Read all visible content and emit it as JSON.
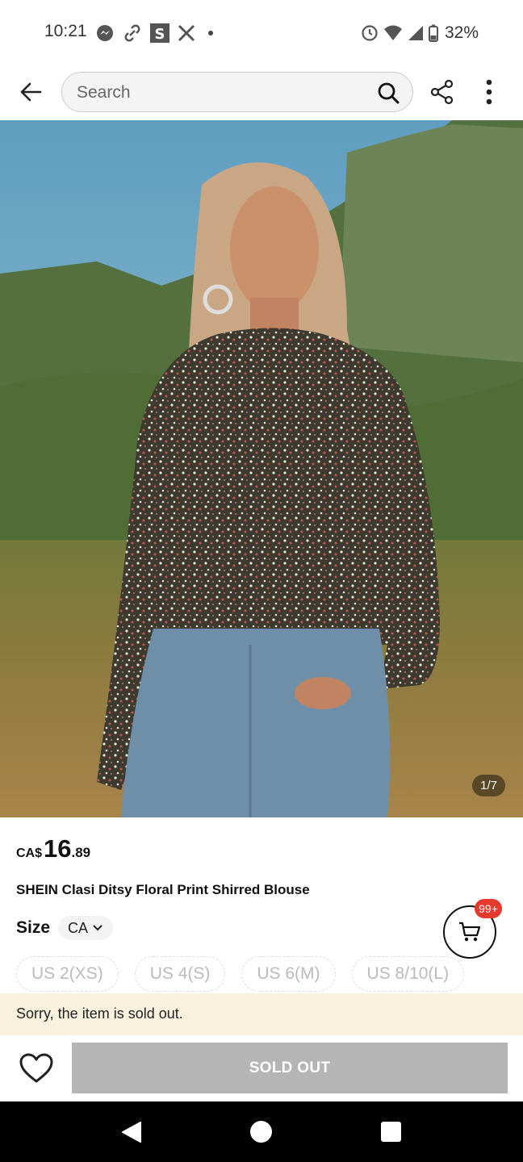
{
  "status_bar": {
    "time": "10:21",
    "battery": "32%",
    "icons": [
      "messenger-icon",
      "link-icon",
      "s-app-icon",
      "x-icon",
      "dot-icon",
      "alarm-icon",
      "wifi-icon",
      "signal-icon",
      "battery-icon"
    ]
  },
  "header": {
    "search_placeholder": "Search",
    "icons": [
      "back-arrow-icon",
      "search-icon",
      "share-icon",
      "more-vertical-icon"
    ]
  },
  "gallery": {
    "counter": "1/7"
  },
  "product": {
    "price_currency": "CA$",
    "price_whole": "16",
    "price_decimal": ".89",
    "title": "SHEIN Clasi Ditsy Floral Print Shirred Blouse"
  },
  "size": {
    "label": "Size",
    "region": "CA",
    "options": [
      "US 2(XS)",
      "US 4(S)",
      "US 6(M)",
      "US 8/10(L)"
    ]
  },
  "cart": {
    "badge": "99+"
  },
  "notice": {
    "text": "Sorry, the item is sold out."
  },
  "actions": {
    "sold_out_label": "SOLD OUT"
  },
  "colors": {
    "accent_red": "#e8392f",
    "notice_bg": "#faf1de",
    "disabled_button": "#b5b5b5"
  }
}
